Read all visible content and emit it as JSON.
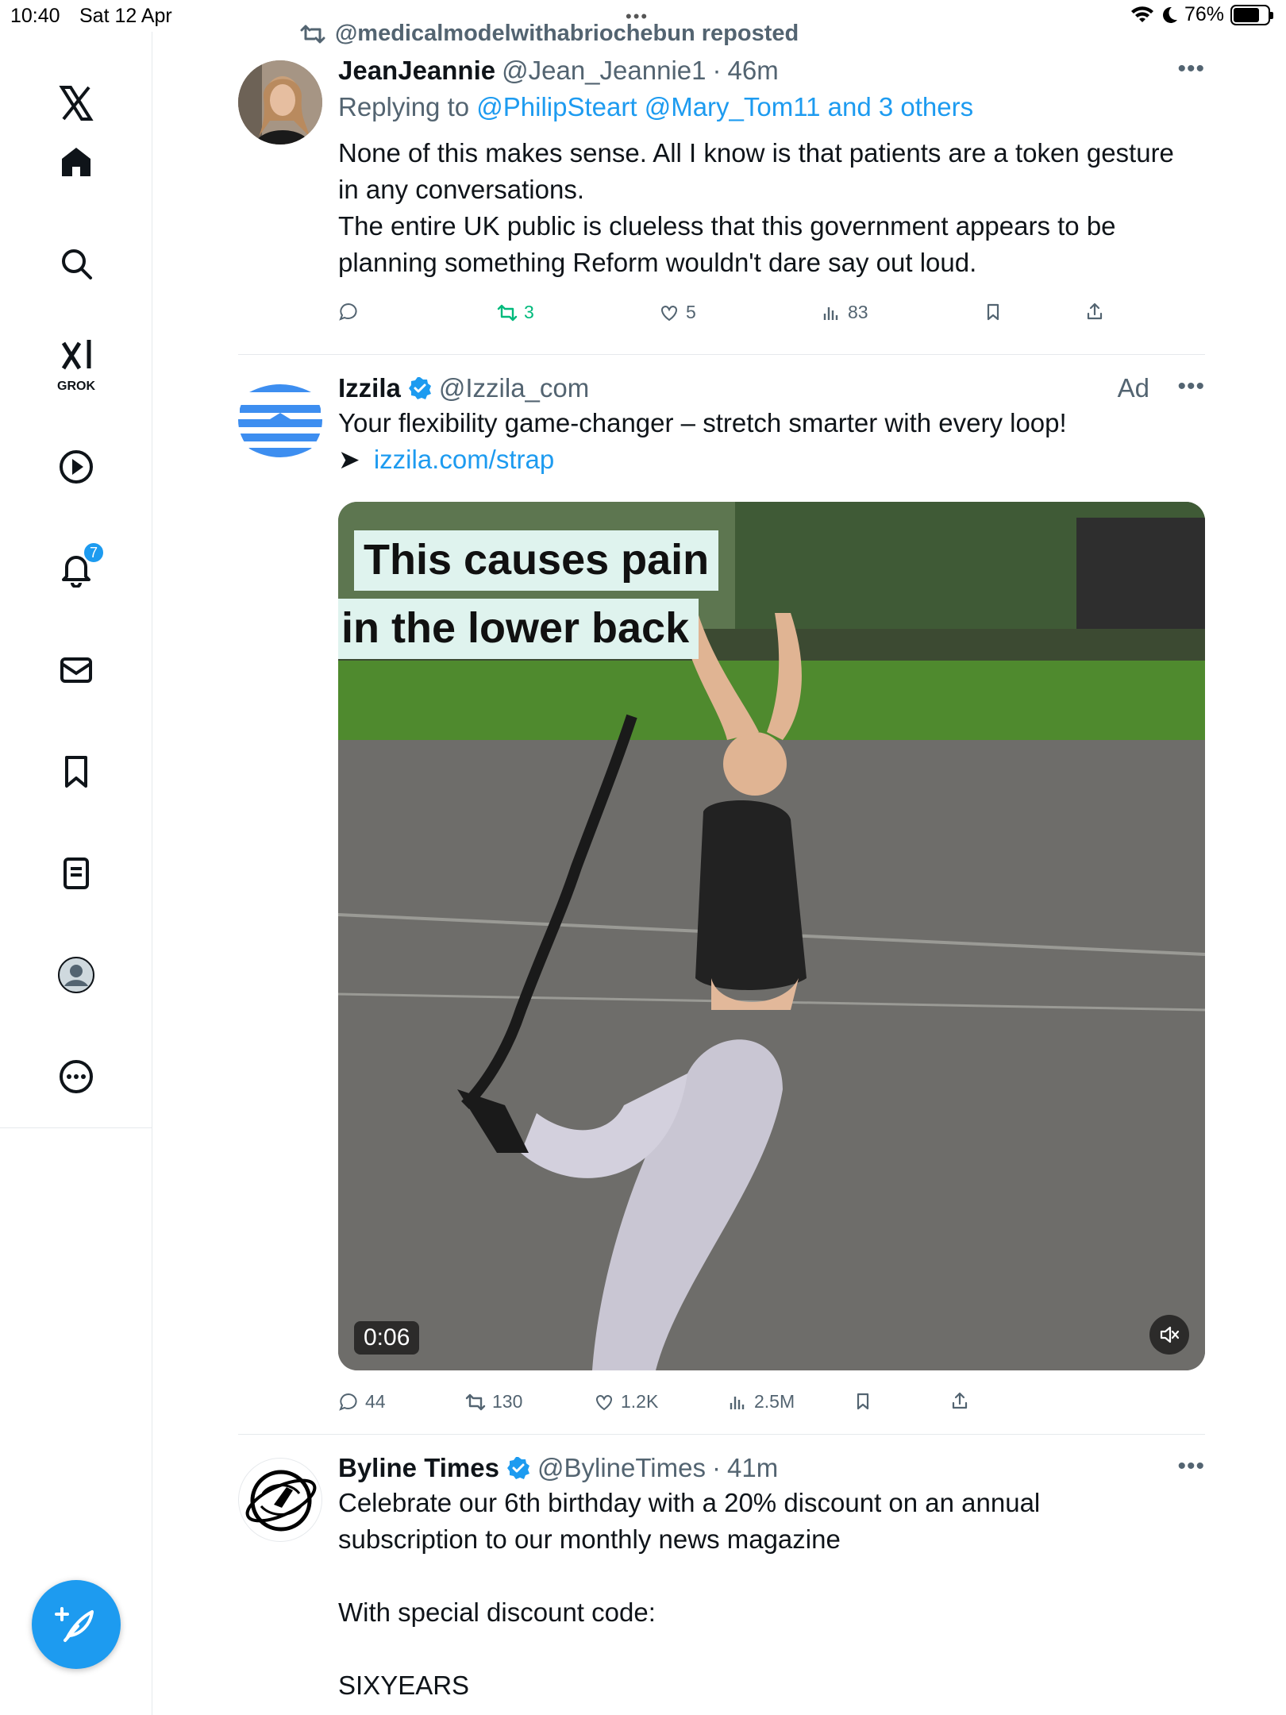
{
  "status_bar": {
    "time": "10:40",
    "date": "Sat 12 Apr",
    "battery": "76%",
    "battery_level": 0.76
  },
  "sidebar": {
    "grok_label": "GROK",
    "notifications_badge": "7"
  },
  "feed": {
    "tweets": [
      {
        "repost_context": "@medicalmodelwithabriochebun reposted",
        "name": "JeanJeannie",
        "handle": "@Jean_Jeannie1",
        "time": "46m",
        "replying_prefix": "Replying to",
        "replying_to": "@PhilipSteart @Mary_Tom11 and 3 others",
        "text_lines": [
          "None of this makes sense. All I know is that patients are a token gesture",
          "in any conversations.",
          "The entire UK public is clueless that this government appears to be",
          "planning something Reform wouldn't dare say out loud."
        ],
        "stats": {
          "replies": "",
          "reposts": "3",
          "likes": "5",
          "views": "83"
        }
      },
      {
        "name": "Izzila",
        "handle": "@Izzila_com",
        "ad_label": "Ad",
        "text": "Your flexibility game-changer – stretch smarter with every loop!",
        "arrow": "➤",
        "link": "izzila.com/strap",
        "video": {
          "caption_line1": "This causes pain",
          "caption_line2": "in the lower back",
          "duration": "0:06"
        },
        "stats": {
          "replies": "44",
          "reposts": "130",
          "likes": "1.2K",
          "views": "2.5M"
        }
      },
      {
        "name": "Byline Times",
        "handle": "@BylineTimes",
        "time": "41m",
        "text_lines": [
          "Celebrate our 6th birthday with a 20% discount on an annual",
          "subscription to our monthly news magazine"
        ],
        "text_line3": "With special discount code:",
        "text_line4": "SIXYEARS"
      }
    ]
  },
  "colors": {
    "accent": "#1d9bf0",
    "repost_green": "#00ba7c",
    "muted": "#536471"
  }
}
